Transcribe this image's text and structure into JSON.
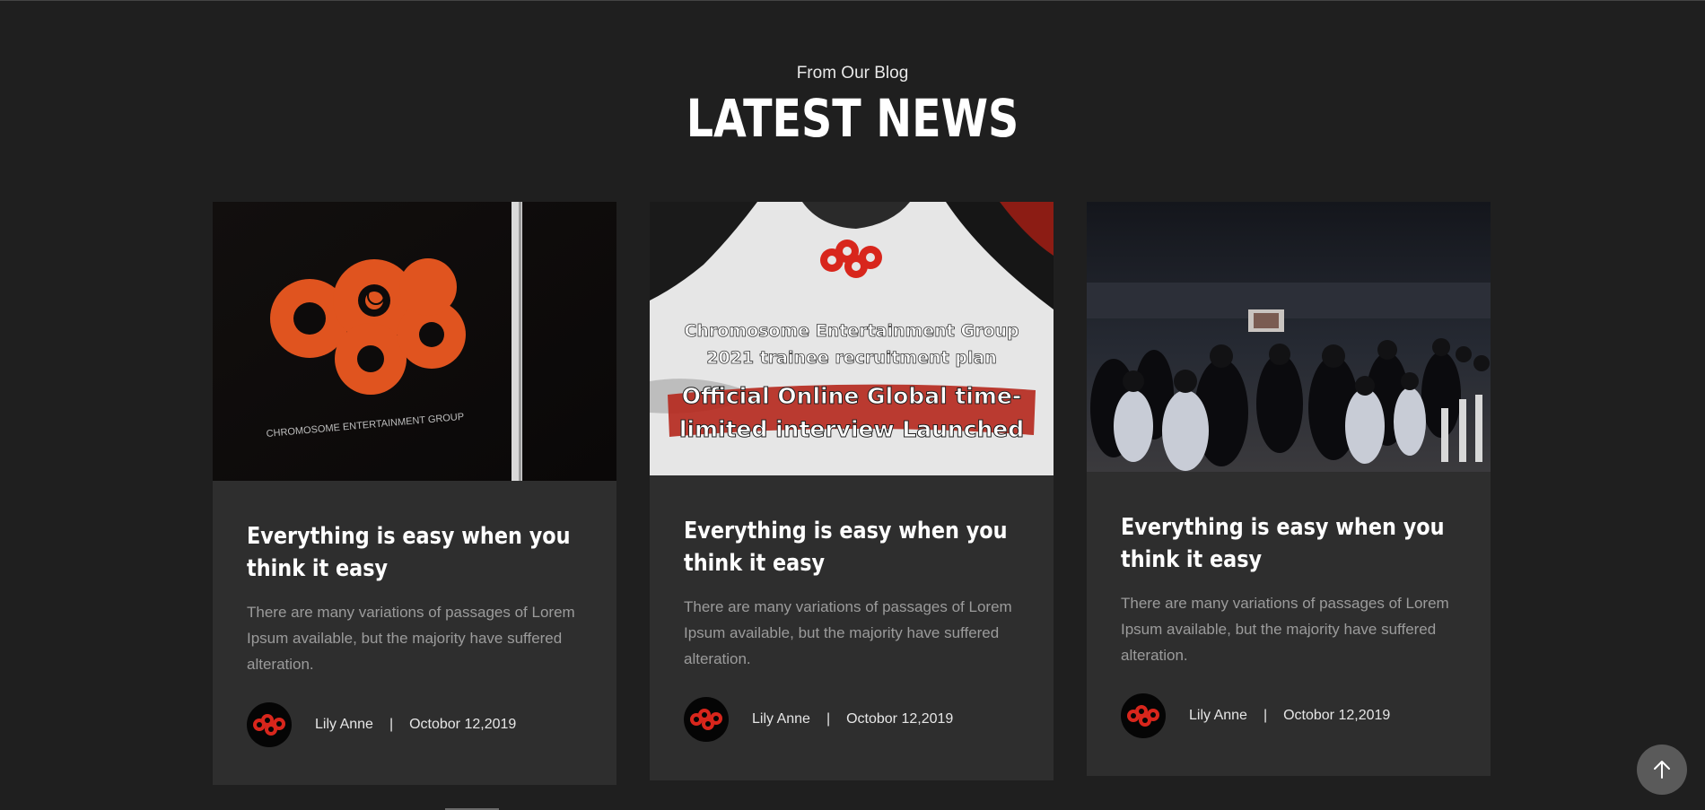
{
  "header": {
    "subtitle": "From Our Blog",
    "title": "LATEST NEWS"
  },
  "cards": [
    {
      "image": {
        "type": "logo-photo",
        "logo_caption": "CHROMOSOME ENTERTAINMENT GROUP"
      },
      "title": "Everything is easy when you think it easy",
      "excerpt": "There are many variations of passages of Lorem Ipsum available, but the majority have suffered alteration.",
      "author": "Lily Anne",
      "separator": "|",
      "date": "Octobor 12,2019"
    },
    {
      "image": {
        "type": "poster",
        "poster_line1": "Chromosome Entertainment Group",
        "poster_line2": "2021 trainee recruitment plan",
        "poster_line3": "Official Online Global time-",
        "poster_line4": "limited interview Launched"
      },
      "title": "Everything is easy when you think it easy",
      "excerpt": "There are many variations of passages of Lorem Ipsum available, but the majority have suffered alteration.",
      "author": "Lily Anne",
      "separator": "|",
      "date": "Octobor 12,2019"
    },
    {
      "image": {
        "type": "audience-photo"
      },
      "title": "Everything is easy when you think it easy",
      "excerpt": "There are many variations of passages of Lorem Ipsum available, but the majority have suffered alteration.",
      "author": "Lily Anne",
      "separator": "|",
      "date": "Octobor 12,2019"
    }
  ],
  "scroll_top": {
    "icon": "arrow-up-icon"
  },
  "colors": {
    "background": "#1f1f1f",
    "card": "#2e2e2e",
    "brand_red": "#d8261c",
    "brand_orange": "#e0541f"
  }
}
